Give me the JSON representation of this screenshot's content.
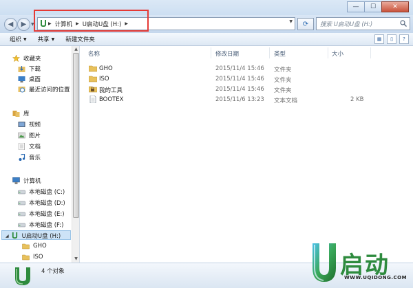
{
  "window": {
    "controls": {
      "minimize": "—",
      "maximize": "☐",
      "close": "✕"
    }
  },
  "address": {
    "segments": [
      "计算机",
      "U启动U盘 (H:)"
    ],
    "search_placeholder": "搜索 U启动U盘 (H:)"
  },
  "toolbar": {
    "organize": "组织",
    "share": "共享",
    "new_folder": "新建文件夹"
  },
  "nav": {
    "favorites": "收藏夹",
    "downloads": "下载",
    "desktop": "桌面",
    "recent": "最近访问的位置",
    "libraries": "库",
    "videos": "视频",
    "pictures": "图片",
    "documents": "文档",
    "music": "音乐",
    "computer": "计算机",
    "drives": [
      "本地磁盘 (C:)",
      "本地磁盘 (D:)",
      "本地磁盘 (E:)",
      "本地磁盘 (F:)"
    ],
    "usb": "U启动U盘 (H:)",
    "usb_children": [
      "GHO",
      "ISO"
    ]
  },
  "columns": {
    "name": "名称",
    "modified": "修改日期",
    "type": "类型",
    "size": "大小"
  },
  "files": [
    {
      "name": "GHO",
      "modified": "2015/11/4 15:46",
      "type": "文件夹",
      "size": "",
      "icon": "folder-icon"
    },
    {
      "name": "ISO",
      "modified": "2015/11/4 15:46",
      "type": "文件夹",
      "size": "",
      "icon": "folder-icon"
    },
    {
      "name": "我的工具",
      "modified": "2015/11/4 15:46",
      "type": "文件夹",
      "size": "",
      "icon": "folder-lock-icon"
    },
    {
      "name": "BOOTEX",
      "modified": "2015/11/6 13:23",
      "type": "文本文档",
      "size": "2 KB",
      "icon": "text-file-icon"
    }
  ],
  "status": {
    "count": "4 个对象"
  },
  "logo": {
    "text": "启动",
    "url": "WWW.UQIDONG.COM"
  },
  "colors": {
    "accent": "#2a6ab3",
    "highlight": "#e53935",
    "logo_green": "#2e8b3e"
  }
}
